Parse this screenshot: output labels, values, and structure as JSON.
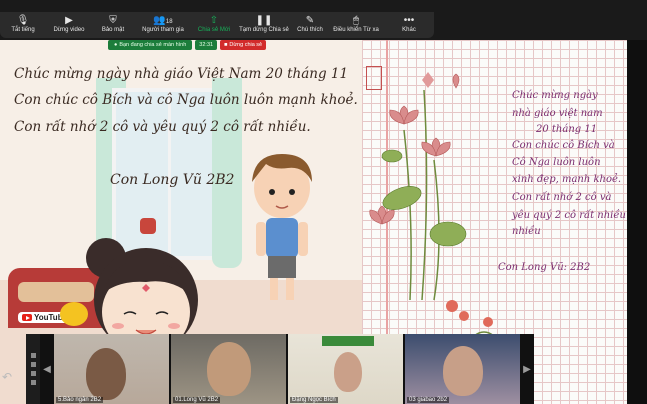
{
  "toolbar": {
    "items": [
      {
        "label": "Tắt tiếng",
        "icon": "microphone-icon"
      },
      {
        "label": "Dừng video",
        "icon": "video-camera-icon"
      },
      {
        "label": "Bảo mật",
        "icon": "shield-icon"
      },
      {
        "label": "Người tham gia",
        "icon": "participants-icon",
        "count": "18"
      },
      {
        "label": "Chia sẻ Mới",
        "icon": "share-screen-icon"
      },
      {
        "label": "Tạm dừng Chia sẻ",
        "icon": "pause-icon"
      },
      {
        "label": "Chú thích",
        "icon": "annotate-pen-icon"
      },
      {
        "label": "Điều khiển Từ xa",
        "icon": "remote-control-icon"
      },
      {
        "label": "Khác",
        "icon": "more-icon"
      }
    ]
  },
  "share_bar": {
    "status": "Bạn đang chia sẻ màn hình",
    "timer": "32:31",
    "stop_label": "Dừng chia sẻ"
  },
  "slide": {
    "lines": [
      "Chúc mừng ngày nhà giáo Việt Nam 20 tháng 11",
      "Con chúc cô Bích và cô Nga luôn luôn mạnh khoẻ.",
      "Con rất nhớ 2 cô và yêu quý 2 cô rất nhiều."
    ],
    "signature": "Con Long Vũ 2B2",
    "youtube_label": "YouTube"
  },
  "notebook": {
    "lines": [
      "Chúc mừng ngày",
      "nhà giáo việt nam",
      "20 tháng 11",
      "Con chúc cô Bích và",
      "Cô Nga luôn luôn",
      "xinh đẹp, mạnh khoẻ.",
      "Con rất nhớ 2 cô và",
      "yêu quý 2 cô rất nhiều",
      "nhiều"
    ],
    "signature": "Con Long Vũ: 2B2"
  },
  "gallery": {
    "participants": [
      {
        "name": "5.Bảo ngân 2B2"
      },
      {
        "name": "01.Long Vũ 2B2"
      },
      {
        "name": "Đặng Ngọc Bích"
      },
      {
        "name": "03 giabao 2b2"
      }
    ]
  },
  "colors": {
    "toolbar_bg": "#2b2b2b",
    "share_green": "#17b35a",
    "stop_red": "#d22b2b",
    "notebook_ink": "#7a2d6f"
  }
}
